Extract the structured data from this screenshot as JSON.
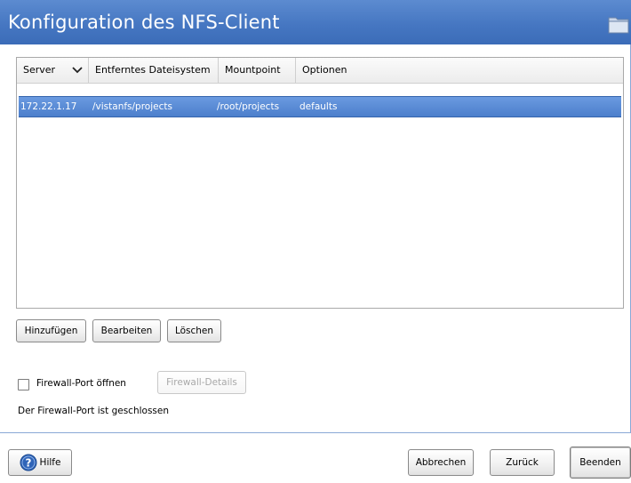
{
  "window": {
    "title": "Konfiguration des NFS-Client",
    "icon": "folder-icon"
  },
  "table": {
    "columns": [
      {
        "label": "Server",
        "sort_icon": "chevron-down-icon"
      },
      {
        "label": "Entferntes Dateisystem"
      },
      {
        "label": "Mountpoint"
      },
      {
        "label": "Optionen"
      }
    ],
    "rows": [
      {
        "server": "172.22.1.17",
        "remote_fs": "/vistanfs/projects",
        "mountpoint": "/root/projects",
        "options": "defaults",
        "selected": true
      }
    ]
  },
  "actions": {
    "add": "Hinzufügen",
    "edit": "Bearbeiten",
    "delete": "Löschen"
  },
  "firewall": {
    "checkbox_label": "Firewall-Port öffnen",
    "checked": false,
    "details_button": "Firewall-Details",
    "status": "Der Firewall-Port ist geschlossen"
  },
  "footer": {
    "help": "Hilfe",
    "help_icon": "help-icon",
    "cancel": "Abbrechen",
    "back": "Zurück",
    "finish": "Beenden"
  },
  "colors": {
    "titlebar": "#4677c2",
    "selection": "#4c7fcc"
  }
}
